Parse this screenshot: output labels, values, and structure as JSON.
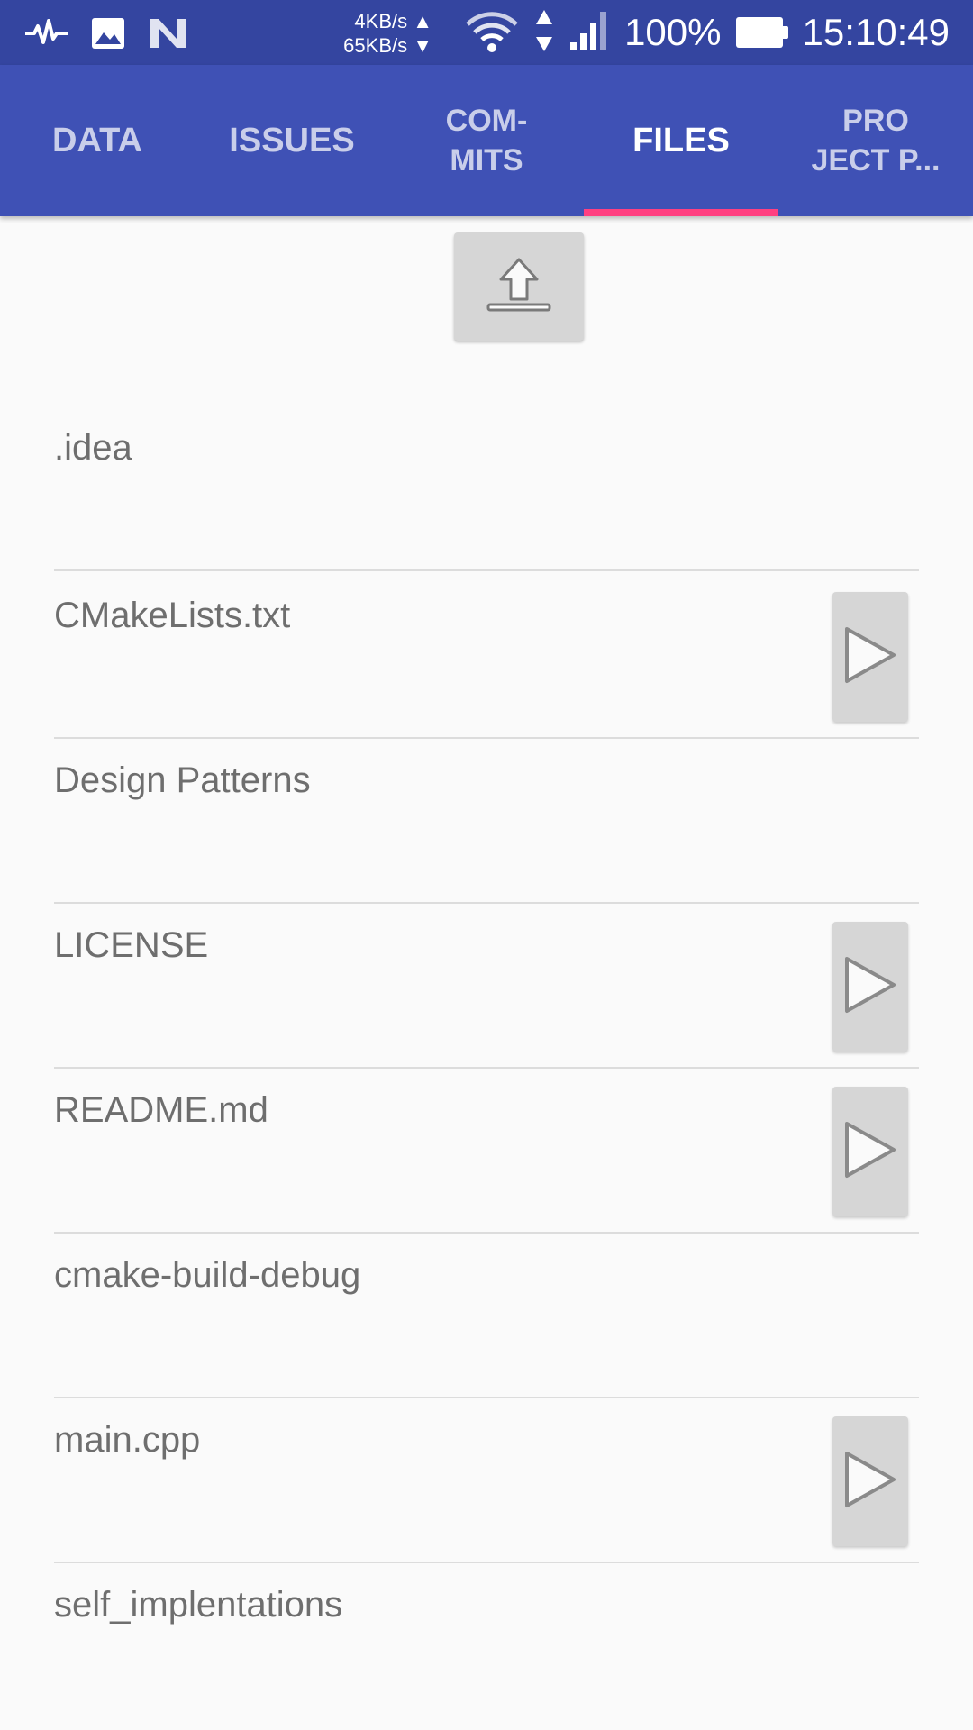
{
  "status_bar": {
    "icons_left": [
      "activity-icon",
      "image-icon",
      "n-logo-icon"
    ],
    "upload_speed": "4KB/s ▲",
    "download_speed": "65KB/s ▼",
    "battery_percent": "100%",
    "time": "15:10:49"
  },
  "tabs": [
    {
      "label": "DATA",
      "active": false
    },
    {
      "label": "ISSUES",
      "active": false
    },
    {
      "label": "COM-\nMITS",
      "active": false
    },
    {
      "label": "FILES",
      "active": true
    },
    {
      "label": "PRO\nJECT P...",
      "active": false
    }
  ],
  "toolbar": {
    "upload_icon": "upload-icon"
  },
  "files": [
    {
      "name": ".idea",
      "has_open_button": false
    },
    {
      "name": "CMakeLists.txt",
      "has_open_button": true
    },
    {
      "name": "Design Patterns",
      "has_open_button": false
    },
    {
      "name": "LICENSE",
      "has_open_button": true
    },
    {
      "name": "README.md",
      "has_open_button": true
    },
    {
      "name": "cmake-build-debug",
      "has_open_button": false
    },
    {
      "name": "main.cpp",
      "has_open_button": true
    },
    {
      "name": "self_implentations",
      "has_open_button": false
    }
  ],
  "colors": {
    "status_bar": "#3445a0",
    "tab_bar": "#3f51b5",
    "indicator": "#ff4081",
    "background": "#fafafa"
  }
}
